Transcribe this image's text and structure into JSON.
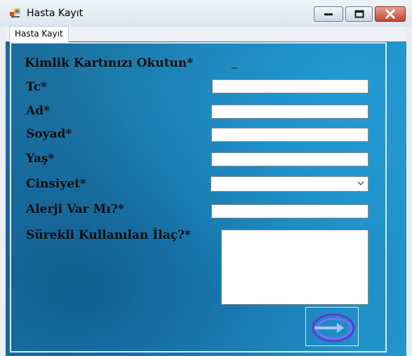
{
  "window": {
    "title": "Hasta Kayıt",
    "tab_label": "Hasta Kayıt"
  },
  "form": {
    "id_card_label": "Kimlik Kartınızı Okutun*",
    "id_card_value": "_",
    "tc_label": "Tc*",
    "ad_label": "Ad*",
    "soyad_label": "Soyad*",
    "yas_label": "Yaş*",
    "cinsiyet_label": "Cinsiyet*",
    "alerji_label": "Alerji Var Mı?*",
    "ilac_label": "Sürekli Kullanılan İlaç?*",
    "tc_value": "",
    "ad_value": "",
    "soyad_value": "",
    "yas_value": "",
    "cinsiyet_value": "",
    "alerji_value": "",
    "ilac_value": ""
  },
  "icons": {
    "app": "app-icon",
    "minimize": "minimize-icon",
    "maximize": "maximize-icon",
    "close": "close-icon",
    "dropdown": "chevron-down-icon",
    "next": "arrow-right-icon"
  },
  "colors": {
    "form_background": "#1a86bd",
    "close_button": "#c24430"
  }
}
